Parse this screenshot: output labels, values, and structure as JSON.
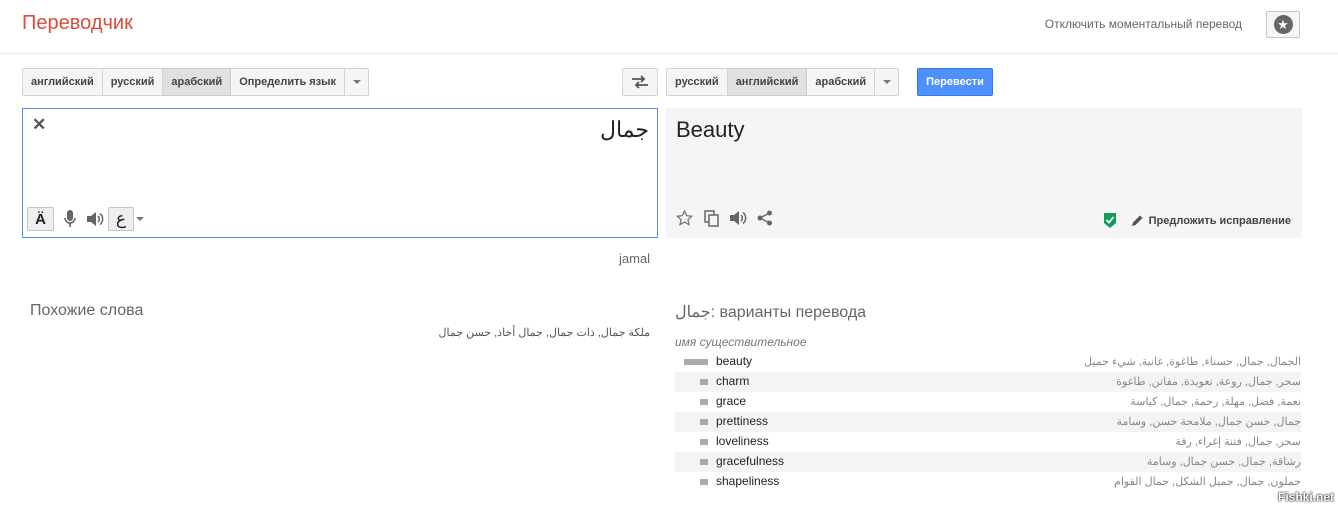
{
  "header": {
    "brand": "Переводчик",
    "instant_toggle": "Отключить моментальный перевод"
  },
  "source_langs": [
    "английский",
    "русский",
    "арабский",
    "Определить язык"
  ],
  "source_selected": "арабский",
  "target_langs": [
    "русский",
    "английский",
    "арабский"
  ],
  "target_selected": "английский",
  "translate_button": "Перевести",
  "source": {
    "text": "جمال",
    "transliteration": "jamal",
    "keyboard_char": "ع",
    "handwrite_char": "Ä"
  },
  "target": {
    "text": "Beauty",
    "suggest_label": "Предложить исправление"
  },
  "related": {
    "title": "Похожие слова",
    "words": "ملكة جمال, ذات جمال, جمال أخاذ, حسن جمال"
  },
  "dictionary": {
    "word": "جمال",
    "title_suffix": ": варианты перевода",
    "pos": "имя существительное",
    "entries": [
      {
        "word": "beauty",
        "reverse": "الجمال, جمال, حسناء, طاغوة, غانية, شيء جميل",
        "frequency": 1.0
      },
      {
        "word": "charm",
        "reverse": "سحر, جمال, روعة, تعويذة, مفاتن, طاغوة",
        "frequency": 0.33
      },
      {
        "word": "grace",
        "reverse": "نعمة, فضل, مهلة, رحمة, جمال, كياسة",
        "frequency": 0.33
      },
      {
        "word": "prettiness",
        "reverse": "جمال, حسن جمال, ملامحة حسن, وسامة",
        "frequency": 0.33
      },
      {
        "word": "loveliness",
        "reverse": "سحر, جمال, فتنة إغراء, رقة",
        "frequency": 0.33
      },
      {
        "word": "gracefulness",
        "reverse": "رشاقة, جمال, حسن جمال, وسامة",
        "frequency": 0.33
      },
      {
        "word": "shapeliness",
        "reverse": "جملون, جمال, جميل الشكل, جمال القوام",
        "frequency": 0.33
      }
    ]
  },
  "watermark": "Fishki.net",
  "colors": {
    "brand": "#dd4b39",
    "accent": "#4d90fe",
    "verified": "#0f9d58"
  }
}
